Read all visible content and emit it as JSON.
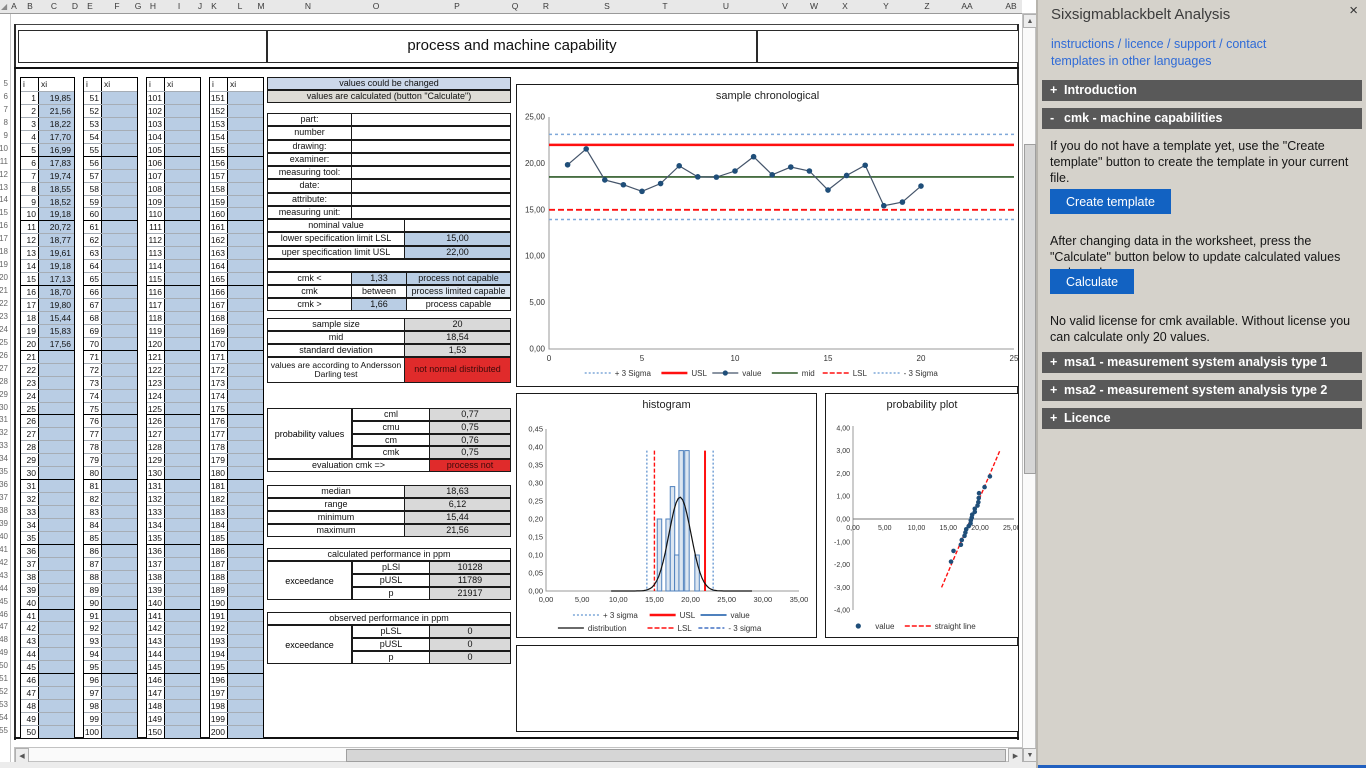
{
  "spreadsheet": {
    "column_letters": [
      "A",
      "B",
      "C",
      "D",
      "E",
      "F",
      "G",
      "H",
      "I",
      "J",
      "K",
      "L",
      "M",
      "N",
      "O",
      "P",
      "Q",
      "R",
      "S",
      "T",
      "U",
      "V",
      "W",
      "X",
      "Y",
      "Z",
      "AA",
      "AB"
    ],
    "row_numbers": {
      "first": 5,
      "last": 55
    },
    "sheet_title": "process and machine capability",
    "data_table": {
      "i_header": "i",
      "xi_header": "xi",
      "groups": [
        {
          "first": 1,
          "last": 50
        },
        {
          "first": 51,
          "last": 100
        },
        {
          "first": 101,
          "last": 150
        },
        {
          "first": 151,
          "last": 200
        }
      ],
      "values": [
        "19,85",
        "21,56",
        "18,22",
        "17,70",
        "16,99",
        "17,83",
        "19,74",
        "18,55",
        "18,52",
        "19,18",
        "20,72",
        "18,77",
        "19,61",
        "19,18",
        "17,13",
        "18,70",
        "19,80",
        "15,44",
        "15,83",
        "17,56"
      ]
    },
    "info": {
      "banner1": "values could be changed",
      "banner2": "values are calculated (button \"Calculate\")",
      "meta_labels": [
        "part:",
        "number",
        "drawing:",
        "examiner:",
        "measuring tool:",
        "date:",
        "attribute:",
        "measuring unit:"
      ],
      "nominal_label": "nominal value",
      "lsl_label": "lower specification limit LSL",
      "lsl_value": "15,00",
      "usl_label": "uper specification limit USL",
      "usl_value": "22,00",
      "cmk_rows": [
        [
          "cmk <",
          "1,33",
          "process not capable"
        ],
        [
          "cmk",
          "between",
          "process limited capable"
        ],
        [
          "cmk >",
          "1,66",
          "process capable"
        ]
      ],
      "stats_rows": [
        [
          "sample size",
          "20"
        ],
        [
          "mid",
          "18,54"
        ],
        [
          "standard deviation",
          "1,53"
        ]
      ],
      "normality_label": "values are according to Andersson Darling test",
      "normality_value": "not normal distributed",
      "prob_group_label": "probability values",
      "prob_rows": [
        [
          "cml",
          "0,77"
        ],
        [
          "cmu",
          "0,75"
        ],
        [
          "cm",
          "0,76"
        ],
        [
          "cmk",
          "0,75"
        ]
      ],
      "evaluation_label": "evaluation cmk =>",
      "evaluation_value": "process not capable",
      "summary_rows": [
        [
          "median",
          "18,63"
        ],
        [
          "range",
          "6,12"
        ],
        [
          "minimum",
          "15,44"
        ],
        [
          "maximum",
          "21,56"
        ]
      ],
      "calc_perf_title": "calculated performance in ppm",
      "exceedance_label": "exceedance",
      "calc_perf_rows": [
        [
          "pLSl",
          "10128"
        ],
        [
          "pUSL",
          "11789"
        ],
        [
          "p",
          "21917"
        ]
      ],
      "obs_perf_title": "observed performance in ppm",
      "obs_perf_rows": [
        [
          "pLSL",
          "0"
        ],
        [
          "pUSL",
          "0"
        ],
        [
          "p",
          "0"
        ]
      ]
    }
  },
  "chart_data": [
    {
      "type": "line",
      "title": "sample chronological",
      "values": [
        19.85,
        21.56,
        18.22,
        17.7,
        16.99,
        17.83,
        19.74,
        18.55,
        18.52,
        19.18,
        20.72,
        18.77,
        19.61,
        19.18,
        17.13,
        18.7,
        19.8,
        15.44,
        15.83,
        17.56
      ],
      "mid": 18.54,
      "usl": 22,
      "lsl": 15,
      "sigma_plus": 23.13,
      "sigma_minus": 13.95,
      "xlim": [
        0,
        25
      ],
      "ylim": [
        0,
        25
      ],
      "xticks": [
        0,
        5,
        10,
        15,
        20,
        25
      ],
      "ytick_step": 5,
      "legend": [
        {
          "label": "+ 3 Sigma",
          "sw": "dot-lblue"
        },
        {
          "label": "USL",
          "sw": "solid-red"
        },
        {
          "label": "value",
          "sw": "marker-line"
        },
        {
          "label": "mid",
          "sw": "solid-green"
        },
        {
          "label": "LSL",
          "sw": "dash-red"
        },
        {
          "label": "- 3 Sigma",
          "sw": "dot-lblue"
        }
      ]
    },
    {
      "type": "bar",
      "title": "histogram",
      "bars": [
        [
          15.7,
          0.2
        ],
        [
          16.9,
          0.2
        ],
        [
          17.5,
          0.29
        ],
        [
          18.1,
          0.1
        ],
        [
          18.7,
          0.39
        ],
        [
          19.5,
          0.39
        ],
        [
          20.9,
          0.1
        ]
      ],
      "bar_width": 0.62,
      "normal_curve": {
        "mean": 18.54,
        "sd": 1.53
      },
      "usl": 22,
      "lsl": 15,
      "sigma_plus": 23.13,
      "sigma_minus": 13.95,
      "xlim": [
        0,
        35
      ],
      "xtick_step": 5,
      "ylim": [
        0,
        0.45
      ],
      "ytick_step": 0.05,
      "legend_rows": [
        [
          {
            "label": "+ 3 sigma",
            "sw": "dot-lblue"
          },
          {
            "label": "USL",
            "sw": "solid-red"
          },
          {
            "label": "value",
            "sw": "solid-blue"
          }
        ],
        [
          {
            "label": "distribution",
            "sw": "solid-black"
          },
          {
            "label": "LSL",
            "sw": "dash-red"
          },
          {
            "label": "- 3 sigma",
            "sw": "dash-blue"
          }
        ]
      ]
    },
    {
      "type": "scatter",
      "title": "probability plot",
      "sorted_values": [
        15.44,
        15.83,
        16.99,
        17.13,
        17.56,
        17.7,
        17.83,
        18.22,
        18.52,
        18.55,
        18.7,
        18.77,
        19.18,
        19.18,
        19.61,
        19.74,
        19.8,
        19.85,
        20.72,
        21.56
      ],
      "z_scores": [
        -1.87,
        -1.4,
        -1.13,
        -0.92,
        -0.74,
        -0.59,
        -0.45,
        -0.31,
        -0.19,
        -0.06,
        0.06,
        0.19,
        0.31,
        0.45,
        0.59,
        0.74,
        0.92,
        1.13,
        1.4,
        1.87
      ],
      "straight_line": {
        "x1": 13.95,
        "z1": -3,
        "x2": 23.13,
        "z2": 3
      },
      "xlim": [
        0,
        25
      ],
      "xtick_step": 5,
      "ylim": [
        -4,
        4
      ],
      "ytick_step": 1,
      "legend": [
        {
          "label": "value",
          "sw": "dot-navy"
        },
        {
          "label": "straight line",
          "sw": "dash-red"
        }
      ]
    }
  ],
  "taskpane": {
    "title": "Sixsigmablackbelt Analysis",
    "links_line1": "instructions / licence / support / contact",
    "links_line2": "templates in other languages",
    "sections": [
      {
        "prefix": "+",
        "label": "Introduction"
      },
      {
        "prefix": "-",
        "label": "cmk - machine capabilities"
      },
      {
        "prefix": "+",
        "label": "msa1 - measurement system analysis type 1"
      },
      {
        "prefix": "+",
        "label": "msa2 - measurement system analysis type 2"
      },
      {
        "prefix": "+",
        "label": "Licence"
      }
    ],
    "para1": "If you do not have a template yet, use the \"Create template\" button to create the template in your current file.",
    "create_button": "Create template",
    "para2": "After changing data in the worksheet, press the \"Calculate\" button below to update calculated values and graphs.",
    "calculate_button": "Calculate",
    "license_note": "No valid license for cmk available. Without license you can calculate only 20 values."
  },
  "icons": {
    "up": "▲",
    "down": "▼",
    "left": "◀",
    "right": "▶",
    "select_all": "◢",
    "close": "×"
  },
  "colors": {
    "panel_bg": "#D5D2CB",
    "section_bg": "#595959",
    "accent_blue": "#1262C2",
    "link_blue": "#2F6BD7",
    "cell_blue": "#B9CDE4",
    "cell_blue_light": "#DCE6F1",
    "cell_gray": "#D9D9D9",
    "alert_red": "#E02B2B",
    "alert_text": "#3D0A0A",
    "usl_red": "#FF1010",
    "mid_green": "#2D5A27",
    "sigma_blue": "#7FA8D9",
    "sigma_blue_dark": "#4472C4",
    "series_line": "#44546A",
    "series_navy": "#1F4E79",
    "bar_stroke": "#4F81BD",
    "bar_fill": "#DCE6F1",
    "bottom_blue": "#2160C0",
    "banner_blue": "#CCD8EA",
    "banner_gray": "#DEDCD6"
  }
}
